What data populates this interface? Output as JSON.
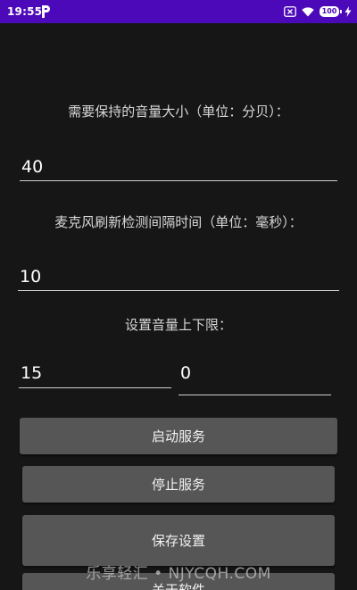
{
  "status_bar": {
    "time": "19:55",
    "battery": "100",
    "background": "#4b09ba",
    "icons": [
      "app-p-icon",
      "no-sim-icon",
      "wifi-icon",
      "battery-icon",
      "charging-icon"
    ]
  },
  "form": {
    "volume_label": "需要保持的音量大小（单位：分贝）：",
    "volume_value": "40",
    "interval_label": "麦克风刷新检测间隔时间（单位：毫秒）：",
    "interval_value": "10",
    "limits_label": "设置音量上下限：",
    "upper_limit_value": "15",
    "lower_limit_value": "0"
  },
  "buttons": {
    "start": "启动服务",
    "stop": "停止服务",
    "save": "保存设置",
    "about": "关于软件"
  },
  "watermark": "乐享轻汇 • NJYCQH.COM",
  "colors": {
    "background": "#161616",
    "button": "#565656",
    "text": "#e6e6e6"
  }
}
